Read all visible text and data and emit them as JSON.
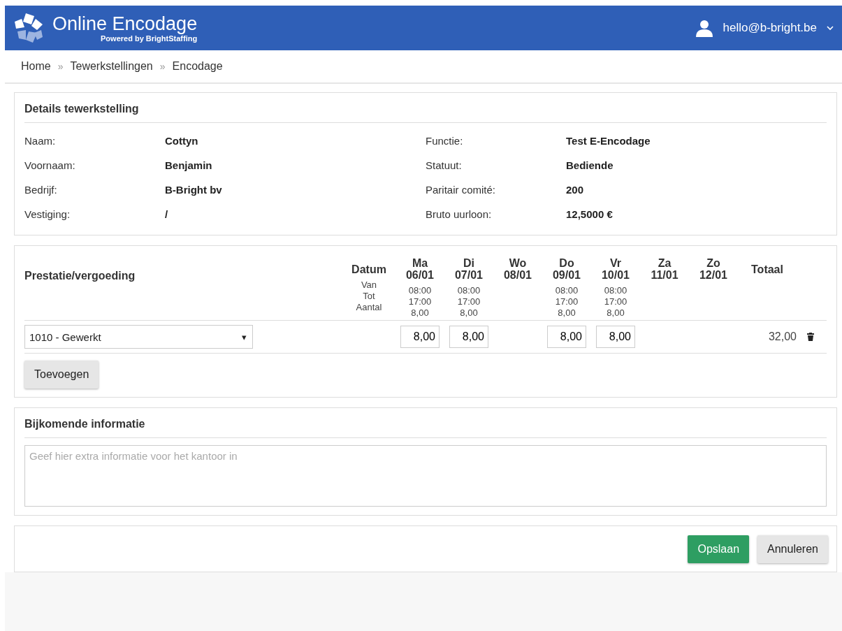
{
  "header": {
    "title": "Online Encodage",
    "subtitle": "Powered by BrightStaffing",
    "user": "hello@b-bright.be"
  },
  "breadcrumb": {
    "separator": "»",
    "items": [
      "Home",
      "Tewerkstellingen",
      "Encodage"
    ]
  },
  "details": {
    "title": "Details tewerkstelling",
    "left": [
      {
        "label": "Naam:",
        "value": "Cottyn"
      },
      {
        "label": "Voornaam:",
        "value": "Benjamin"
      },
      {
        "label": "Bedrijf:",
        "value": "B-Bright bv"
      },
      {
        "label": "Vestiging:",
        "value": "/"
      }
    ],
    "right": [
      {
        "label": "Functie:",
        "value": "Test E-Encodage"
      },
      {
        "label": "Statuut:",
        "value": "Bediende"
      },
      {
        "label": "Paritair comité:",
        "value": "200"
      },
      {
        "label": "Bruto uurloon:",
        "value": "12,5000 €"
      }
    ]
  },
  "prestaties": {
    "title": "Prestatie/vergoeding",
    "date_heading": "Datum",
    "sub_labels": [
      "Van",
      "Tot",
      "Aantal"
    ],
    "total_heading": "Totaal",
    "days": [
      {
        "day": "Ma",
        "date": "06/01",
        "van": "08:00",
        "tot": "17:00",
        "aantal": "8,00"
      },
      {
        "day": "Di",
        "date": "07/01",
        "van": "08:00",
        "tot": "17:00",
        "aantal": "8,00"
      },
      {
        "day": "Wo",
        "date": "08/01"
      },
      {
        "day": "Do",
        "date": "09/01",
        "van": "08:00",
        "tot": "17:00",
        "aantal": "8,00"
      },
      {
        "day": "Vr",
        "date": "10/01",
        "van": "08:00",
        "tot": "17:00",
        "aantal": "8,00"
      },
      {
        "day": "Za",
        "date": "11/01"
      },
      {
        "day": "Zo",
        "date": "12/01"
      }
    ],
    "rows": [
      {
        "code": "1010 - Gewerkt",
        "caret": "▾",
        "cells": [
          {
            "kind": "input",
            "value": "8,00"
          },
          {
            "kind": "input",
            "value": "8,00"
          },
          {
            "kind": "empty"
          },
          {
            "kind": "input",
            "value": "8,00"
          },
          {
            "kind": "input",
            "value": "8,00"
          },
          {
            "kind": "empty"
          },
          {
            "kind": "empty"
          }
        ],
        "total": "32,00"
      }
    ],
    "add_button": "Toevoegen"
  },
  "info": {
    "title": "Bijkomende informatie",
    "placeholder": "Geef hier extra informatie voor het kantoor in"
  },
  "buttons": {
    "save": "Opslaan",
    "cancel": "Annuleren"
  }
}
